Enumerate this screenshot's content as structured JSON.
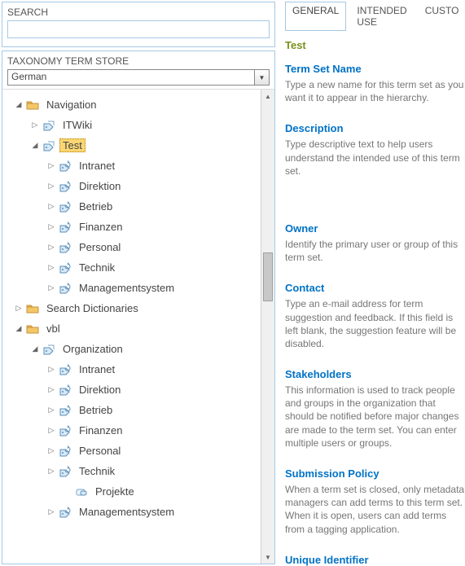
{
  "search": {
    "label": "SEARCH",
    "value": ""
  },
  "taxonomy": {
    "label": "TAXONOMY TERM STORE",
    "language": "German"
  },
  "tree": {
    "navigation": "Navigation",
    "itwiki": "ITWiki",
    "test": "Test",
    "intranet": "Intranet",
    "direktion": "Direktion",
    "betrieb": "Betrieb",
    "finanzen": "Finanzen",
    "personal": "Personal",
    "technik": "Technik",
    "managementsystem": "Managementsystem",
    "search_dictionaries": "Search Dictionaries",
    "vbl": "vbl",
    "organization": "Organization",
    "projekte": "Projekte"
  },
  "tabs": {
    "general": "GENERAL",
    "intended_use": "INTENDED USE",
    "custom": "CUSTO"
  },
  "details": {
    "title": "Test",
    "term_set_name": {
      "label": "Term Set Name",
      "desc": "Type a new name for this term set as you want it to appear in the hierarchy."
    },
    "description": {
      "label": "Description",
      "desc": "Type descriptive text to help users understand the intended use of this term set."
    },
    "owner": {
      "label": "Owner",
      "desc": "Identify the primary user or group of this term set."
    },
    "contact": {
      "label": "Contact",
      "desc": "Type an e-mail address for term suggestion and feedback. If this field is left blank, the suggestion feature will be disabled."
    },
    "stakeholders": {
      "label": "Stakeholders",
      "desc": "This information is used to track people and groups in the organization that should be notified before major changes are made to the term set. You can enter multiple users or groups."
    },
    "submission_policy": {
      "label": "Submission Policy",
      "desc": "When a term set is closed, only metadata managers can add terms to this term set. When it is open, users can add terms from a tagging application."
    },
    "unique_identifier": {
      "label": "Unique Identifier",
      "desc": ""
    }
  }
}
